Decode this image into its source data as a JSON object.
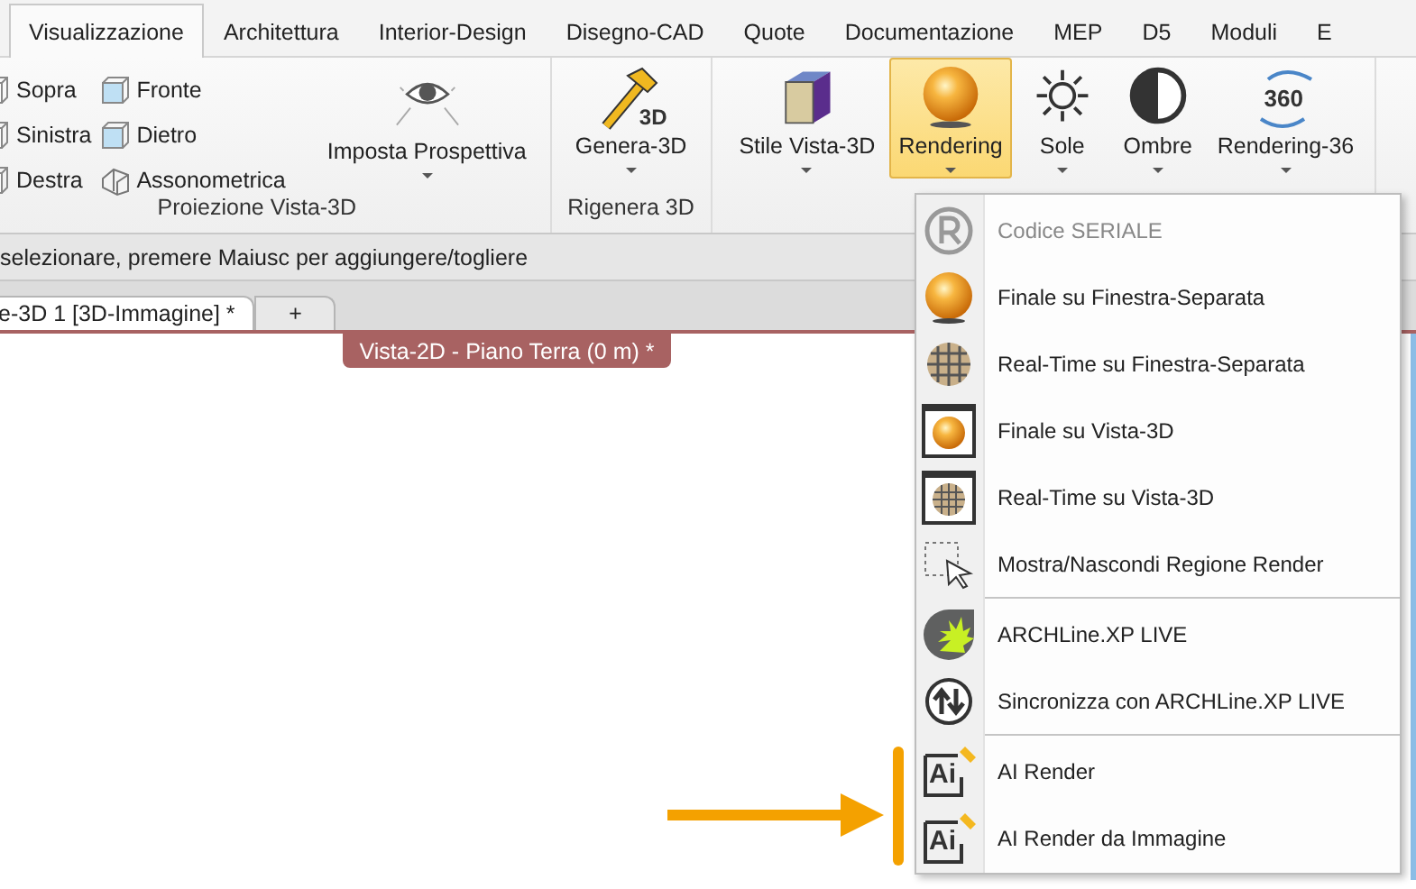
{
  "ribbon_tabs": [
    {
      "label": "Visualizzazione",
      "selected": true
    },
    {
      "label": "Architettura",
      "selected": false
    },
    {
      "label": "Interior-Design",
      "selected": false
    },
    {
      "label": "Disegno-CAD",
      "selected": false
    },
    {
      "label": "Quote",
      "selected": false
    },
    {
      "label": "Documentazione",
      "selected": false
    },
    {
      "label": "MEP",
      "selected": false
    },
    {
      "label": "D5",
      "selected": false
    },
    {
      "label": "Moduli",
      "selected": false
    },
    {
      "label": "E",
      "selected": false
    }
  ],
  "groups": [
    {
      "label": "Proiezione Vista-3D",
      "small_columns": [
        [
          {
            "label": "Sopra",
            "kind": "cube"
          },
          {
            "label": "Sinistra",
            "kind": "cube"
          },
          {
            "label": "Destra",
            "kind": "cube"
          }
        ],
        [
          {
            "label": "Fronte",
            "kind": "cube-front"
          },
          {
            "label": "Dietro",
            "kind": "cube-back"
          },
          {
            "label": "Assonometrica",
            "kind": "house"
          }
        ]
      ],
      "buttons": [
        {
          "label": "Imposta Prospettiva",
          "kind": "eye",
          "selected": false
        }
      ]
    },
    {
      "label": "Rigenera 3D",
      "buttons": [
        {
          "label": "Genera-3D",
          "kind": "hammer",
          "icon_text": "3D",
          "selected": false
        }
      ]
    },
    {
      "buttons": [
        {
          "label": "Stile Vista-3D",
          "kind": "cube3d",
          "selected": false
        },
        {
          "label": "Rendering",
          "kind": "sphere",
          "selected": true
        },
        {
          "label": "Sole",
          "kind": "sun",
          "selected": false
        },
        {
          "label": "Ombre",
          "kind": "contrast",
          "selected": false
        },
        {
          "label": "Rendering-36",
          "kind": "rotate",
          "icon_text": "360",
          "selected": false
        }
      ]
    }
  ],
  "status_bar": {
    "text": "selezionare, premere Maiusc per aggiungere/togliere"
  },
  "document_tabs": [
    {
      "label": "e-3D 1 [3D-Immagine] *",
      "selected": true
    },
    {
      "label": "+",
      "selected": false
    }
  ],
  "view_title": "Vista-2D - Piano Terra (0 m) *",
  "rendering_menu": [
    {
      "label": "Codice SERIALE",
      "kind": "serial",
      "disabled": true
    },
    {
      "label": "Finale su Finestra-Separata",
      "kind": "sphere",
      "disabled": false
    },
    {
      "label": "Real-Time su Finestra-Separata",
      "kind": "grid",
      "disabled": false
    },
    {
      "label": "Finale su Vista-3D",
      "kind": "sphere-window",
      "disabled": false
    },
    {
      "label": "Real-Time su Vista-3D",
      "kind": "grid-window",
      "disabled": false
    },
    {
      "label": "Mostra/Nascondi Regione Render",
      "kind": "region",
      "disabled": false
    },
    {
      "kind": "separator"
    },
    {
      "label": "ARCHLine.XP LIVE",
      "kind": "live",
      "disabled": false
    },
    {
      "label": "Sincronizza con ARCHLine.XP LIVE",
      "kind": "sync",
      "disabled": false
    },
    {
      "kind": "separator"
    },
    {
      "label": "AI Render",
      "kind": "ai",
      "icon_text": "Ai",
      "disabled": false
    },
    {
      "label": "AI Render da Immagine",
      "kind": "ai",
      "icon_text": "Ai",
      "disabled": false
    }
  ]
}
